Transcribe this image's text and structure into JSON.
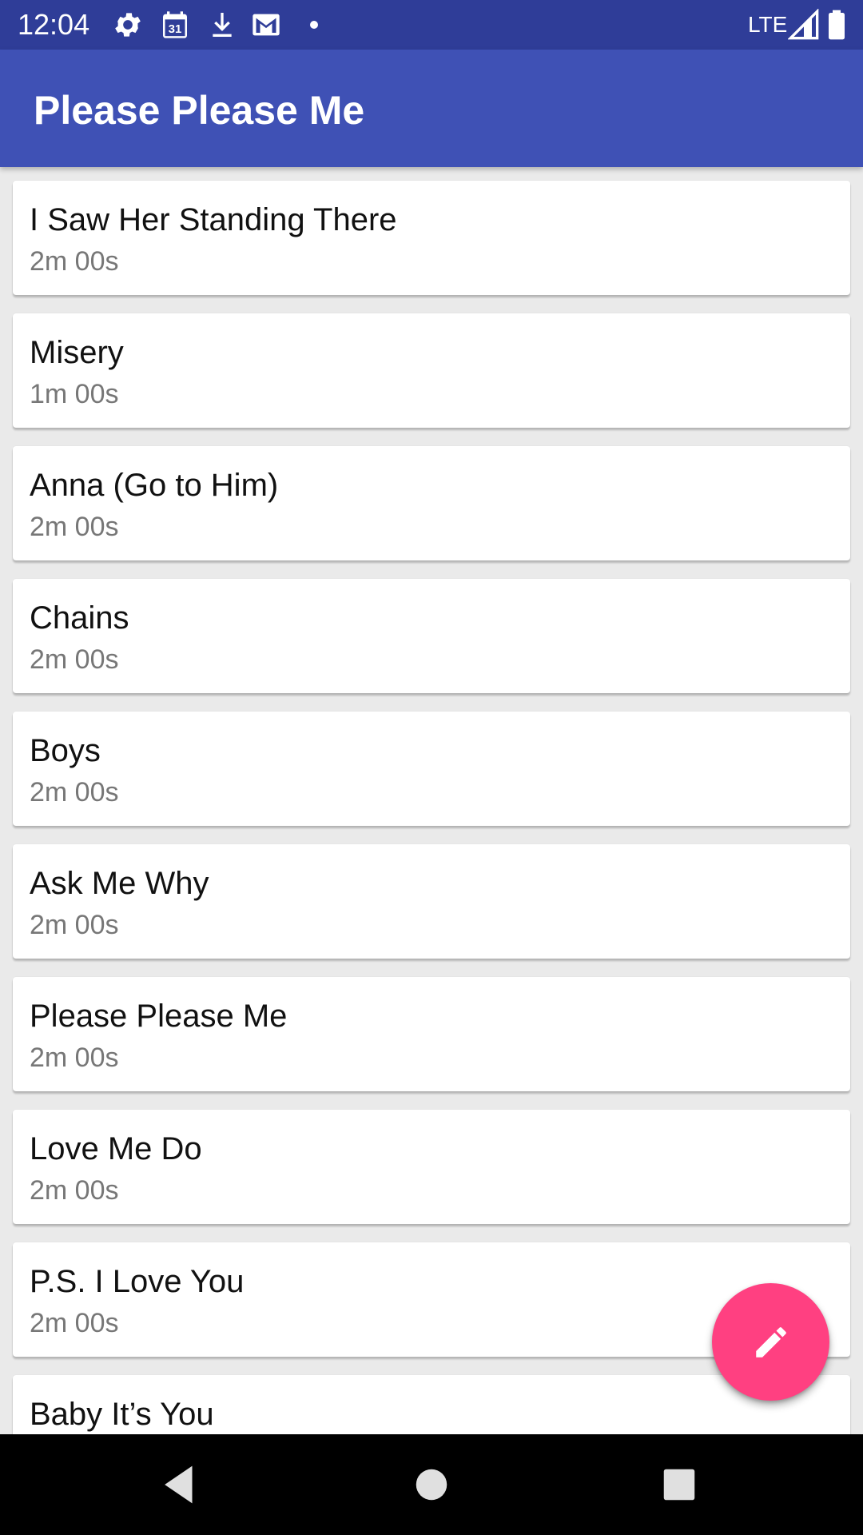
{
  "status_bar": {
    "time": "12:04",
    "network": "LTE",
    "icons": [
      "settings-icon",
      "calendar-icon",
      "download-icon",
      "gmail-icon",
      "notification-dot-icon",
      "signal-icon",
      "battery-icon"
    ],
    "calendar_day": "31"
  },
  "app_bar": {
    "title": "Please Please Me"
  },
  "songs": [
    {
      "title": "I Saw Her Standing There",
      "duration": "2m 00s"
    },
    {
      "title": "Misery",
      "duration": "1m 00s"
    },
    {
      "title": "Anna (Go to Him)",
      "duration": "2m 00s"
    },
    {
      "title": "Chains",
      "duration": "2m 00s"
    },
    {
      "title": "Boys",
      "duration": "2m 00s"
    },
    {
      "title": "Ask Me Why",
      "duration": "2m 00s"
    },
    {
      "title": "Please Please Me",
      "duration": "2m 00s"
    },
    {
      "title": "Love Me Do",
      "duration": "2m 00s"
    },
    {
      "title": "P.S. I Love You",
      "duration": "2m 00s"
    },
    {
      "title": "Baby It’s You",
      "duration": ""
    }
  ],
  "fab": {
    "icon": "edit-icon"
  },
  "nav_bar": {
    "icons": [
      "back-icon",
      "home-icon",
      "recents-icon"
    ]
  },
  "colors": {
    "status_bar": "#2f3d98",
    "app_bar": "#3f51b5",
    "fab": "#ff4081",
    "background": "#eaeaea"
  }
}
